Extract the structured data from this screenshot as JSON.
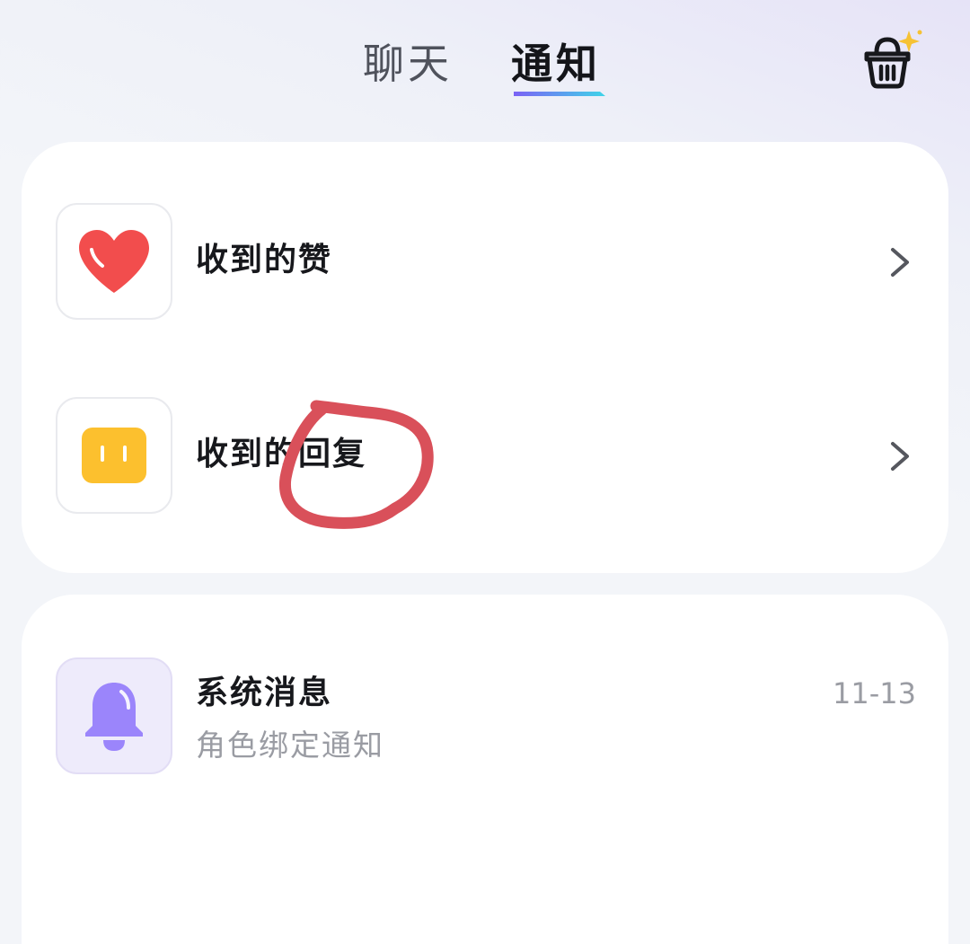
{
  "header": {
    "tabs": [
      {
        "label": "聊天",
        "active": false
      },
      {
        "label": "通知",
        "active": true
      }
    ],
    "basket_icon": "basket-sparkle-icon"
  },
  "notifications": {
    "likes": {
      "label": "收到的赞",
      "icon": "heart-icon",
      "color": "#f24d4d"
    },
    "replies": {
      "label": "收到的回复",
      "icon": "chat-bubble-icon",
      "color": "#fcc02e"
    }
  },
  "messages": [
    {
      "title": "系统消息",
      "subtitle": "角色绑定通知",
      "date": "11-13",
      "icon": "bell-icon",
      "color": "#9b85fb"
    }
  ],
  "colors": {
    "accent_gradient_start": "#7b62f5",
    "accent_gradient_end": "#3fd4e8",
    "annotation": "#d9505a"
  }
}
